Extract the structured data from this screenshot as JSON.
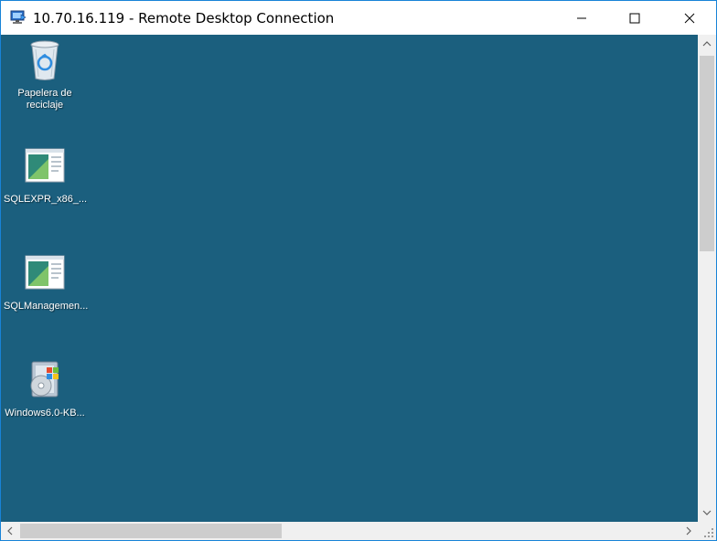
{
  "window": {
    "title": "10.70.16.119 - Remote Desktop Connection",
    "app_icon": "remote-desktop-icon",
    "controls": {
      "minimize_icon": "minimize-icon",
      "maximize_icon": "maximize-icon",
      "close_icon": "close-icon"
    }
  },
  "desktop": {
    "background_color": "#1b5f7e",
    "icons": [
      {
        "label": "Papelera de\nreciclaje",
        "icon": "recycle-bin-icon"
      },
      {
        "label": "SQLEXPR_x86_...",
        "icon": "installer-window-icon"
      },
      {
        "label": "SQLManagemen...",
        "icon": "installer-window-icon"
      },
      {
        "label": "Windows6.0-KB...",
        "icon": "windows-update-package-icon"
      }
    ]
  },
  "scrollbars": {
    "vertical": {
      "up_icon": "chevron-up-icon",
      "down_icon": "chevron-down-icon"
    },
    "horizontal": {
      "left_icon": "chevron-left-icon",
      "right_icon": "chevron-right-icon"
    }
  }
}
